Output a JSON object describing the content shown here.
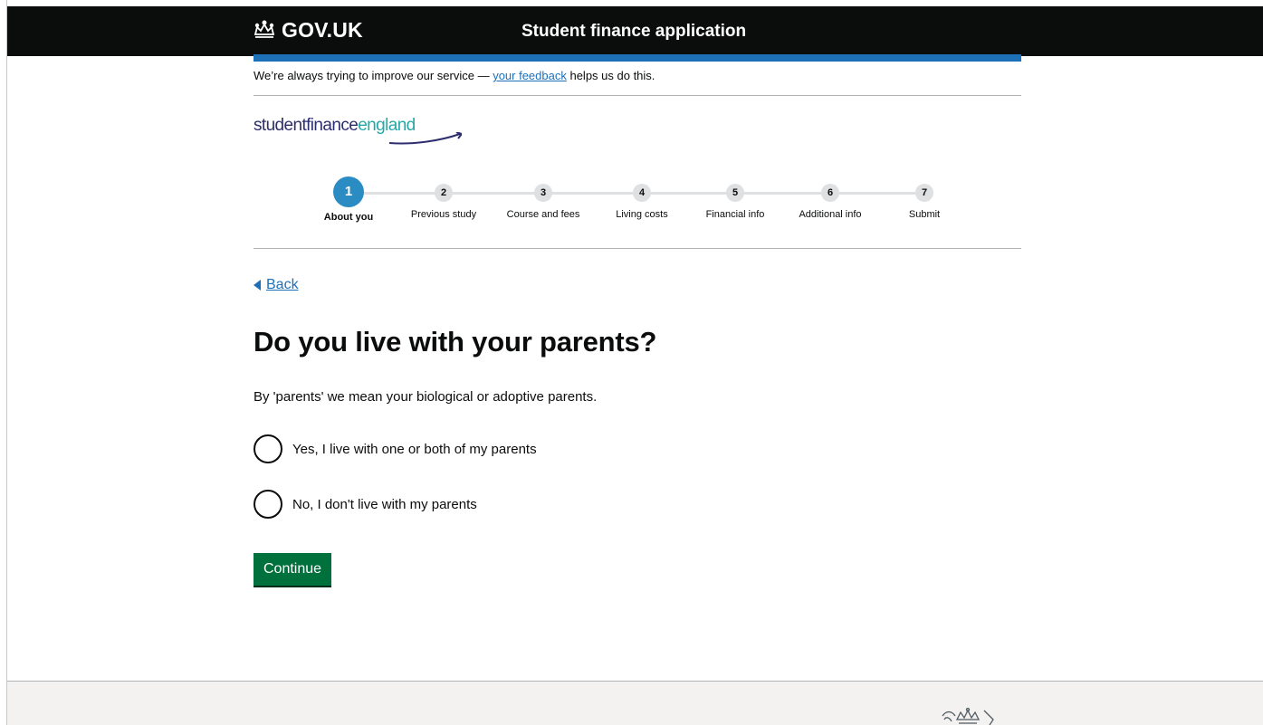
{
  "header": {
    "logo_text": "GOV.UK",
    "service_name": "Student finance application"
  },
  "phase_banner": {
    "text_before": "We’re always trying to improve our service — ",
    "link_text": "your feedback",
    "text_after": " helps us do this."
  },
  "brand_logo": {
    "part1": "studentfinance",
    "part2": "england"
  },
  "steps": [
    {
      "number": "1",
      "label": "About you",
      "active": true
    },
    {
      "number": "2",
      "label": "Previous study",
      "active": false
    },
    {
      "number": "3",
      "label": "Course and fees",
      "active": false
    },
    {
      "number": "4",
      "label": "Living costs",
      "active": false
    },
    {
      "number": "5",
      "label": "Financial info",
      "active": false
    },
    {
      "number": "6",
      "label": "Additional info",
      "active": false
    },
    {
      "number": "7",
      "label": "Submit",
      "active": false
    }
  ],
  "back_link": "Back",
  "question": {
    "heading": "Do you live with your parents?",
    "hint": "By 'parents' we mean your biological or adoptive parents.",
    "options": [
      {
        "label": "Yes, I live with one or both of my parents",
        "checked": false
      },
      {
        "label": "No, I don't live with my parents",
        "checked": false
      }
    ]
  },
  "continue_label": "Continue",
  "colors": {
    "header_bg": "#0b0c0c",
    "brand_blue": "#1d70b8",
    "active_step": "#2b8cc4",
    "button_green": "#00703c",
    "footer_bg": "#f3f2f1"
  }
}
